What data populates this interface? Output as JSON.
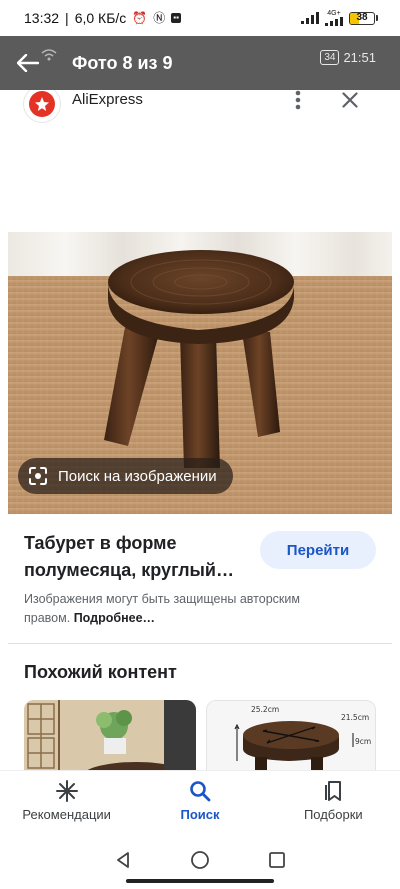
{
  "status_bar": {
    "time": "13:32",
    "speed": "6,0 КБ/с",
    "network": "4G+",
    "battery": "38",
    "battery_level": 0.38
  },
  "photo_header": {
    "title": "Фото 8 из 9",
    "clock": "21:51",
    "badge": "34"
  },
  "source": {
    "name": "AliExpress",
    "more_icon": "vertical-dots-icon",
    "close_icon": "close-icon"
  },
  "image": {
    "lens_label": "Поиск на изображении"
  },
  "product": {
    "title_line1": "Табурет в форме",
    "title_line2": "полумесяца, круглый…",
    "go_label": "Перейти",
    "copyright_text": "Изображения могут быть защищены авторским правом.",
    "more_link": "Подробнее…"
  },
  "similar": {
    "title": "Похожий контент",
    "thumb2_labels": {
      "width": "25.2cm",
      "depth": "21.5cm",
      "height": "9cm"
    }
  },
  "bottom_nav": {
    "items": [
      {
        "label": "Рекомендации",
        "icon": "sparkle-icon"
      },
      {
        "label": "Поиск",
        "icon": "search-icon",
        "active": true
      },
      {
        "label": "Подборки",
        "icon": "bookmarks-icon"
      }
    ]
  },
  "colors": {
    "header_bg": "#5b5b5b",
    "accent": "#1a56c5",
    "go_button_bg": "#e8f0fe",
    "aliexpress_red": "#e43225"
  }
}
